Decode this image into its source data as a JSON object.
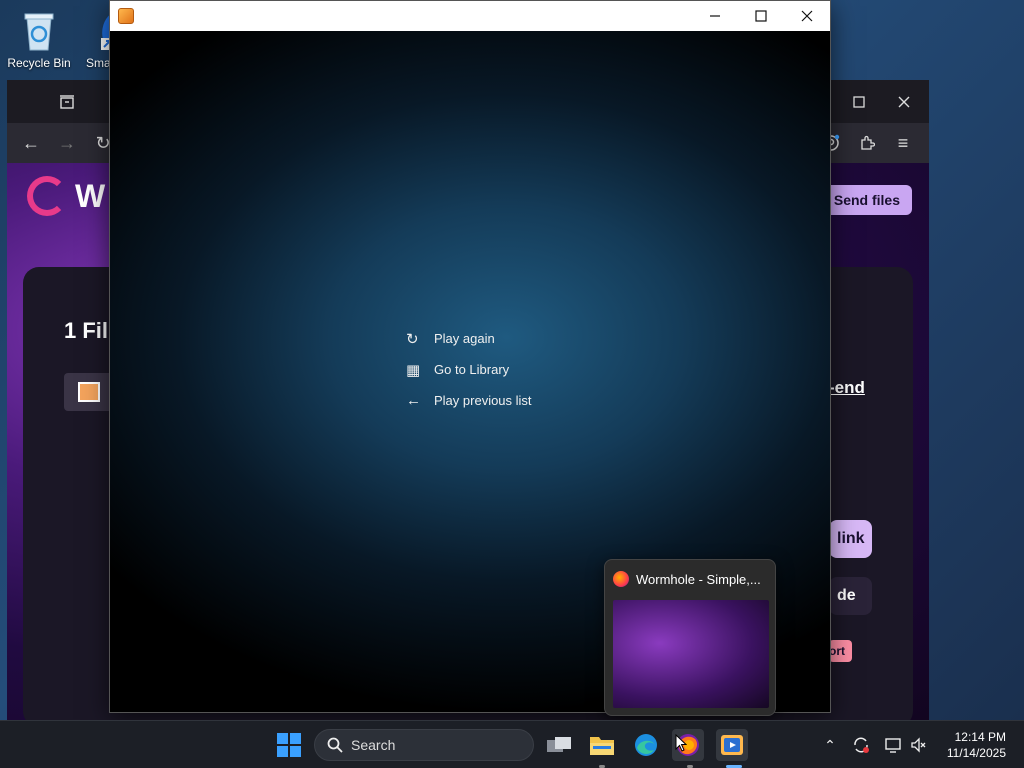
{
  "desktop": {
    "icons": [
      {
        "label": "Recycle Bin"
      },
      {
        "label": "Sma"
      }
    ]
  },
  "browser": {
    "send_files_label": "Send files",
    "logo_text": "W",
    "file_count_peek": "1 Fil",
    "end_peek": "-end",
    "link_peek": "link",
    "de_peek": "de",
    "ort_peek": "ort"
  },
  "player": {
    "menu": [
      {
        "icon": "replay-icon",
        "glyph": "↻",
        "label": "Play again"
      },
      {
        "icon": "library-icon",
        "glyph": "▦",
        "label": "Go to Library"
      },
      {
        "icon": "arrow-left-icon",
        "glyph": "←",
        "label": "Play previous list"
      }
    ]
  },
  "thumbnail": {
    "title": "Wormhole - Simple,..."
  },
  "taskbar": {
    "search_placeholder": "Search",
    "time": "12:14 PM",
    "date": "11/14/2025"
  }
}
